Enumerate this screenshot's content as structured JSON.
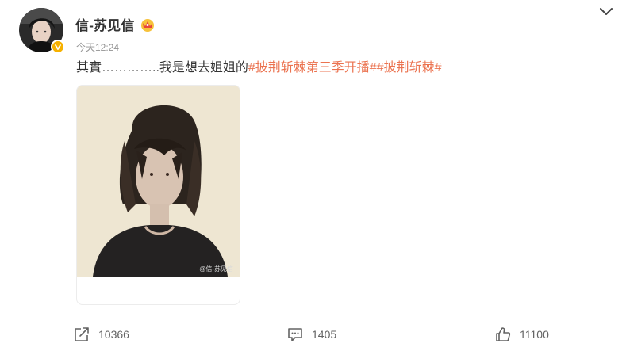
{
  "author": {
    "name": "信-苏见信",
    "avatar": "avatar",
    "verified_icon": "verified-badge-icon",
    "membership_icon": "crown-icon"
  },
  "timestamp": "今天12:24",
  "post": {
    "text": "其實…………..我是想去姐姐的",
    "hashtags": [
      "#披荆斩棘第三季开播#",
      "#披荆斩棘#"
    ],
    "image_watermark": "@信-苏见信"
  },
  "actions": {
    "repost": {
      "icon": "share-icon",
      "count": "10366"
    },
    "comment": {
      "icon": "comment-icon",
      "count": "1405"
    },
    "like": {
      "icon": "thumbs-up-icon",
      "count": "11100"
    }
  },
  "menu": {
    "icon": "chevron-down-icon"
  },
  "colors": {
    "hashtag": "#eb7350",
    "text": "#333333",
    "muted": "#939393",
    "verified": "#f6b100"
  }
}
